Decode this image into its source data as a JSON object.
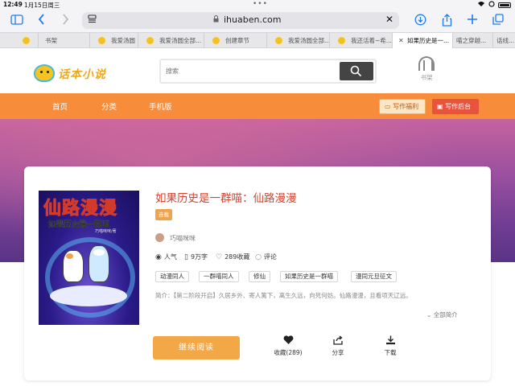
{
  "status_bar": {
    "time": "12:49",
    "date": "1月15日周三",
    "dots": "•••",
    "battery": 1.0
  },
  "browser": {
    "url": "ihuaben.com",
    "tabs": [
      {
        "label": "书架",
        "active": false
      },
      {
        "label": "我爱汤圆",
        "active": false
      },
      {
        "label": "我爱汤圆全部...",
        "active": false
      },
      {
        "label": "创建章节",
        "active": false
      },
      {
        "label": "我爱汤圆全部...",
        "active": false
      },
      {
        "label": "我还活着~希...",
        "active": false
      },
      {
        "label": "如果历史是一...",
        "active": true
      },
      {
        "label": "喵之穿越...",
        "active": false
      },
      {
        "label": "话线...",
        "active": false
      }
    ]
  },
  "site": {
    "logo_text": "话本小说",
    "search_placeholder": "搜索",
    "shelf_label": "书架",
    "nav": [
      "首页",
      "分类",
      "手机版"
    ],
    "btn_welfare": "写作福利",
    "btn_backend": "写作后台",
    "brand_color": "#f78c3a"
  },
  "book": {
    "title": "如果历史是一群喵：仙路漫漫",
    "status": "连载",
    "cover_title": "仙路漫漫",
    "cover_subtitle": "如果历史是一群喵",
    "cover_author": "巧喵咪咪/著",
    "author": "巧喵咪咪",
    "stats": {
      "popularity": "人气",
      "words": "9万字",
      "favorites": "289收藏",
      "comments": "评论"
    },
    "tags": [
      "动漫同人",
      "一群喵同人",
      "修仙",
      "如果历史是一群喵",
      "漫同元旦征文"
    ],
    "intro": "简介：【第二阶段开启】久居乡外、寄人篱下，离生久远，向死何妨。仙路漫漫，且看项天辽远。",
    "more_intro": "全部简介",
    "read_button": "继续阅读",
    "actions": [
      {
        "label": "收藏(289)",
        "icon": "heart-icon"
      },
      {
        "label": "分享",
        "icon": "share-icon"
      },
      {
        "label": "下载",
        "icon": "download-icon"
      }
    ]
  }
}
